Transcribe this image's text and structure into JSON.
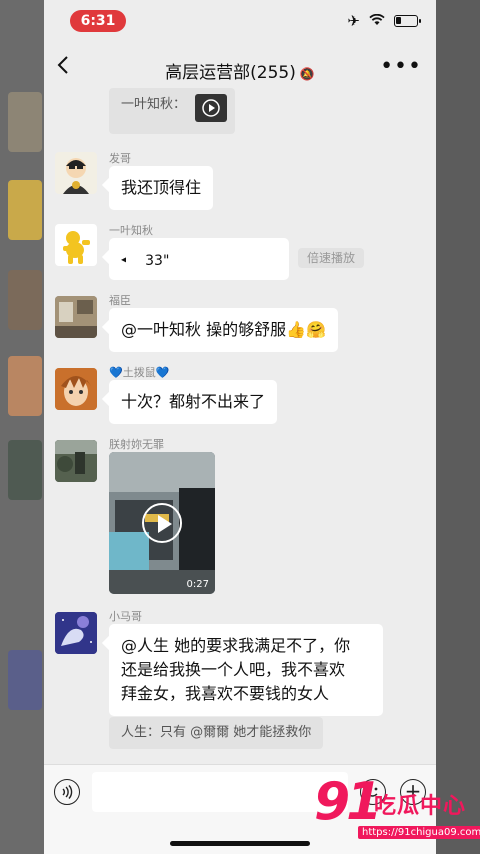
{
  "status_bar": {
    "time": "6:31"
  },
  "nav": {
    "title": "高层运营部(255)",
    "more": "•••"
  },
  "messages": {
    "top_partial": {
      "text": "一叶知秋："
    },
    "m1": {
      "sender": "发哥",
      "text": "我还顶得住"
    },
    "m2": {
      "sender": "一叶知秋",
      "duration": "33\"",
      "hint": "倍速播放"
    },
    "m3": {
      "sender": "福臣",
      "text": "@一叶知秋 操的够舒服👍🤗"
    },
    "m4": {
      "sender": "💙土拨鼠💙",
      "text": "十次？都射不出来了"
    },
    "m5": {
      "sender": "朕射妳无罪",
      "video_duration": "0:27"
    },
    "m6": {
      "sender": "小马哥",
      "lines": [
        "@人生 她的要求我满足不了，你",
        "还是给我换一个人吧，我不喜欢",
        "拜金女，我喜欢不要钱的女人"
      ],
      "quote": "人生：只有 @爾爾 她才能拯救你"
    }
  },
  "input_bar": {
    "value": ""
  },
  "watermark": {
    "logo_91": "91",
    "logo_cn": "吃瓜中心",
    "url": "https://91chigua09.com"
  }
}
